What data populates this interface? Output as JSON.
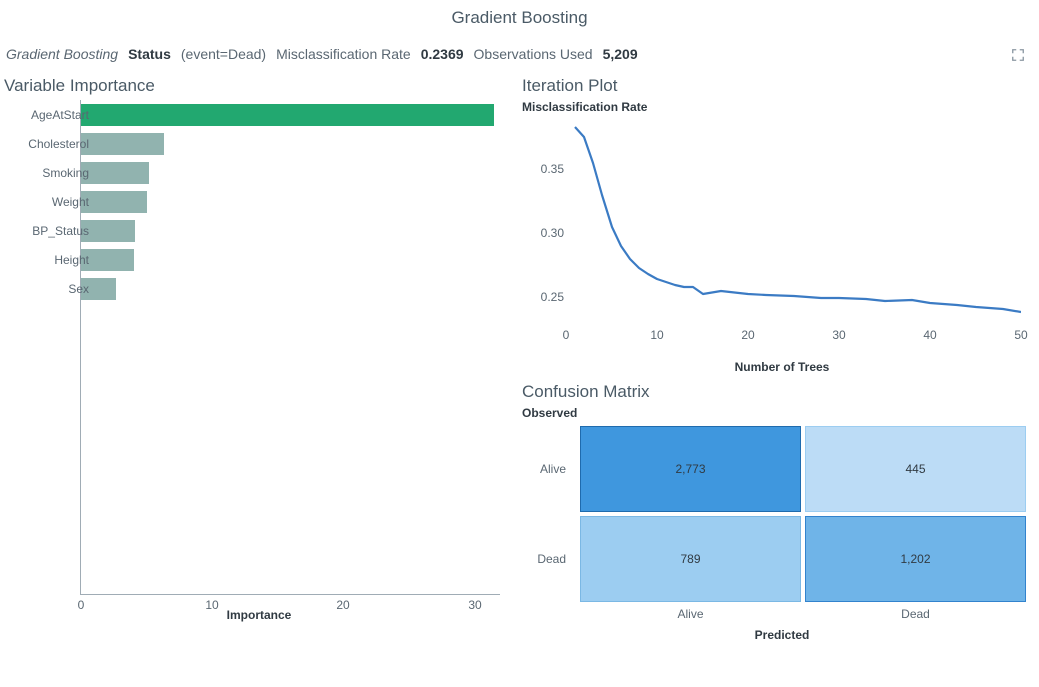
{
  "title": "Gradient Boosting",
  "subheader": {
    "model_name": "Gradient Boosting",
    "target_label": "Status",
    "event": "(event=Dead)",
    "metric_label": "Misclassification Rate",
    "metric_value": "0.2369",
    "obs_label": "Observations Used",
    "obs_value": "5,209"
  },
  "panels": {
    "vi_title": "Variable Importance",
    "vi_xlabel": "Importance",
    "ip_title": "Iteration Plot",
    "ip_sub": "Misclassification Rate",
    "ip_xlabel": "Number of Trees",
    "cm_title": "Confusion Matrix",
    "cm_sub": "Observed",
    "cm_xlabel": "Predicted"
  },
  "vi_labels": {
    "l0": "AgeAtStart",
    "l1": "Cholesterol",
    "l2": "Smoking",
    "l3": "Weight",
    "l4": "BP_Status",
    "l5": "Height",
    "l6": "Sex"
  },
  "vi_ticks": {
    "t0": "0",
    "t10": "10",
    "t20": "20",
    "t30": "30"
  },
  "ip_yticks": {
    "y25": "0.25",
    "y30": "0.30",
    "y35": "0.35"
  },
  "ip_xticks": {
    "x0": "0",
    "x10": "10",
    "x20": "20",
    "x30": "30",
    "x40": "40",
    "x50": "50"
  },
  "cm": {
    "row_alive": "Alive",
    "row_dead": "Dead",
    "col_alive": "Alive",
    "col_dead": "Dead",
    "c00": "2,773",
    "c01": "445",
    "c10": "789",
    "c11": "1,202"
  },
  "chart_data": [
    {
      "type": "bar",
      "title": "Variable Importance",
      "xlabel": "Importance",
      "ylabel": "",
      "orientation": "horizontal",
      "categories": [
        "AgeAtStart",
        "Cholesterol",
        "Smoking",
        "Weight",
        "BP_Status",
        "Height",
        "Sex"
      ],
      "values": [
        31.5,
        6.3,
        5.2,
        5.0,
        4.1,
        4.0,
        2.7
      ],
      "selected_index": 0,
      "xlim": [
        0,
        32
      ],
      "xticks": [
        0,
        10,
        20,
        30
      ]
    },
    {
      "type": "line",
      "title": "Iteration Plot",
      "subtitle": "Misclassification Rate",
      "xlabel": "Number of Trees",
      "ylabel": "Misclassification Rate",
      "xlim": [
        0,
        50
      ],
      "ylim": [
        0.23,
        0.39
      ],
      "xticks": [
        0,
        10,
        20,
        30,
        40,
        50
      ],
      "yticks": [
        0.25,
        0.3,
        0.35
      ],
      "x": [
        1,
        2,
        3,
        4,
        5,
        6,
        7,
        8,
        9,
        10,
        11,
        12,
        13,
        14,
        15,
        17,
        20,
        22,
        25,
        28,
        30,
        33,
        35,
        38,
        40,
        43,
        45,
        48,
        50
      ],
      "y": [
        0.383,
        0.375,
        0.355,
        0.33,
        0.305,
        0.29,
        0.28,
        0.273,
        0.268,
        0.264,
        0.262,
        0.26,
        0.258,
        0.258,
        0.253,
        0.255,
        0.253,
        0.252,
        0.251,
        0.25,
        0.25,
        0.249,
        0.247,
        0.248,
        0.246,
        0.244,
        0.243,
        0.241,
        0.239
      ]
    },
    {
      "type": "heatmap",
      "title": "Confusion Matrix",
      "row_label": "Observed",
      "col_label": "Predicted",
      "rows": [
        "Alive",
        "Dead"
      ],
      "cols": [
        "Alive",
        "Dead"
      ],
      "values": [
        [
          2773,
          445
        ],
        [
          789,
          1202
        ]
      ]
    }
  ]
}
